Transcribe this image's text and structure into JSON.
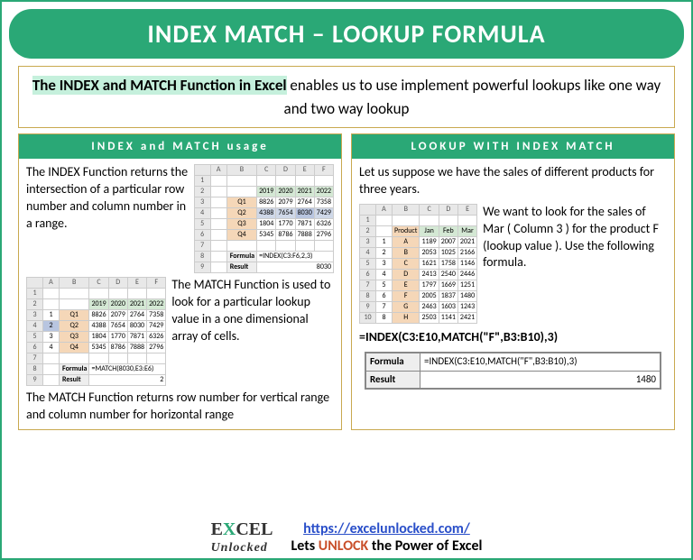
{
  "title": "INDEX MATCH – LOOKUP FORMULA",
  "subtitle": {
    "highlight": "The INDEX and MATCH Function in Excel",
    "rest": " enables us to use implement powerful lookups like one way and two way lookup"
  },
  "left": {
    "header": "INDEX and MATCH usage",
    "index_text": "The INDEX Function returns the intersection of a particular row number and column number in a range.",
    "match_text": "The MATCH Function is used to look for a particular lookup value in a one dimensional array of cells.",
    "match_note": "The MATCH Function returns row number for vertical range and column number for horizontal range",
    "chart_data": {
      "type": "table",
      "columns": [
        "",
        "2019",
        "2020",
        "2021",
        "2022"
      ],
      "rows": [
        {
          "q": "Q1",
          "vals": [
            8826,
            2079,
            2764,
            7358
          ]
        },
        {
          "q": "Q2",
          "vals": [
            4388,
            7654,
            8030,
            7429
          ]
        },
        {
          "q": "Q3",
          "vals": [
            1804,
            1770,
            7871,
            6326
          ]
        },
        {
          "q": "Q4",
          "vals": [
            5345,
            8786,
            7888,
            2796
          ]
        }
      ],
      "index_formula": "=INDEX(C3:F6,2,3)",
      "index_result": 8030,
      "match_formula": "=MATCH(8030,E3:E6)",
      "match_result": 2
    }
  },
  "right": {
    "header": "LOOKUP WITH INDEX MATCH",
    "intro": "Let us suppose we have the sales of different products for three years.",
    "goal": "We want to look for the sales of Mar ( Column 3 ) for the product F (lookup value ). Use the following formula.",
    "formula": "=INDEX(C3:E10,MATCH(\"F\",B3:B10),3)",
    "chart_data": {
      "type": "table",
      "columns": [
        "Product",
        "Jan",
        "Feb",
        "Mar"
      ],
      "rows": [
        {
          "p": "A",
          "vals": [
            1189,
            2007,
            2021
          ]
        },
        {
          "p": "B",
          "vals": [
            2053,
            1025,
            2166
          ]
        },
        {
          "p": "C",
          "vals": [
            1621,
            1758,
            1146
          ]
        },
        {
          "p": "D",
          "vals": [
            2413,
            2540,
            2446
          ]
        },
        {
          "p": "E",
          "vals": [
            1797,
            1669,
            1251
          ]
        },
        {
          "p": "F",
          "vals": [
            2005,
            1837,
            1480
          ]
        },
        {
          "p": "G",
          "vals": [
            2463,
            1603,
            1243
          ]
        },
        {
          "p": "H",
          "vals": [
            2503,
            1141,
            2421
          ]
        }
      ]
    },
    "result_label_formula": "Formula",
    "result_label_result": "Result",
    "result_formula": "=INDEX(C3:E10,MATCH(\"F\",B3:B10),3)",
    "result_value": 1480
  },
  "footer": {
    "url": "https://excelunlocked.com/",
    "tagline_pre": "Lets ",
    "tagline_unlock": "UNLOCK",
    "tagline_post": " the Power of Excel"
  }
}
